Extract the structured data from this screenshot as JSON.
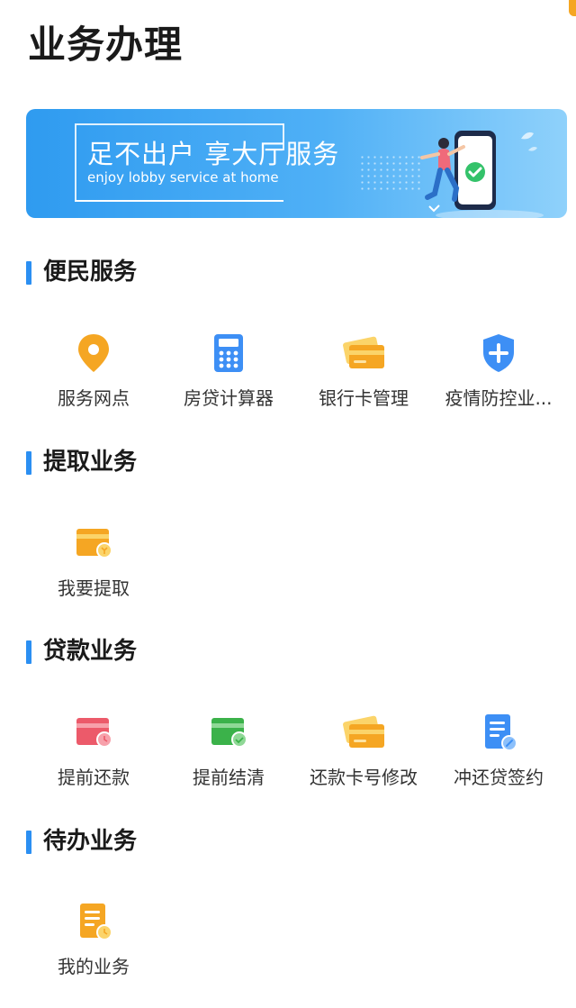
{
  "page_title": "业务办理",
  "banner": {
    "title": "足不出户 享大厅服务",
    "subtitle": "enjoy lobby service at home"
  },
  "colors": {
    "accent_bar": "#2b8ff2",
    "banner_start": "#2f9bf0",
    "banner_end": "#8fd1fb",
    "icon_orange": "#f5a623",
    "icon_blue": "#3d8ff5",
    "icon_red": "#ec5a6a",
    "icon_green": "#3bb24a"
  },
  "sections": [
    {
      "title": "便民服务",
      "items": [
        {
          "label": "服务网点",
          "icon": "location-pin-icon"
        },
        {
          "label": "房贷计算器",
          "icon": "calculator-icon"
        },
        {
          "label": "银行卡管理",
          "icon": "bank-card-icon"
        },
        {
          "label": "疫情防控业...",
          "icon": "shield-plus-icon"
        }
      ]
    },
    {
      "title": "提取业务",
      "items": [
        {
          "label": "我要提取",
          "icon": "wallet-withdraw-icon"
        }
      ]
    },
    {
      "title": "贷款业务",
      "items": [
        {
          "label": "提前还款",
          "icon": "card-clock-icon"
        },
        {
          "label": "提前结清",
          "icon": "card-check-icon"
        },
        {
          "label": "还款卡号修改",
          "icon": "bank-card-icon"
        },
        {
          "label": "冲还贷签约",
          "icon": "document-edit-icon"
        }
      ]
    },
    {
      "title": "待办业务",
      "items": [
        {
          "label": "我的业务",
          "icon": "document-clock-icon"
        }
      ]
    }
  ]
}
